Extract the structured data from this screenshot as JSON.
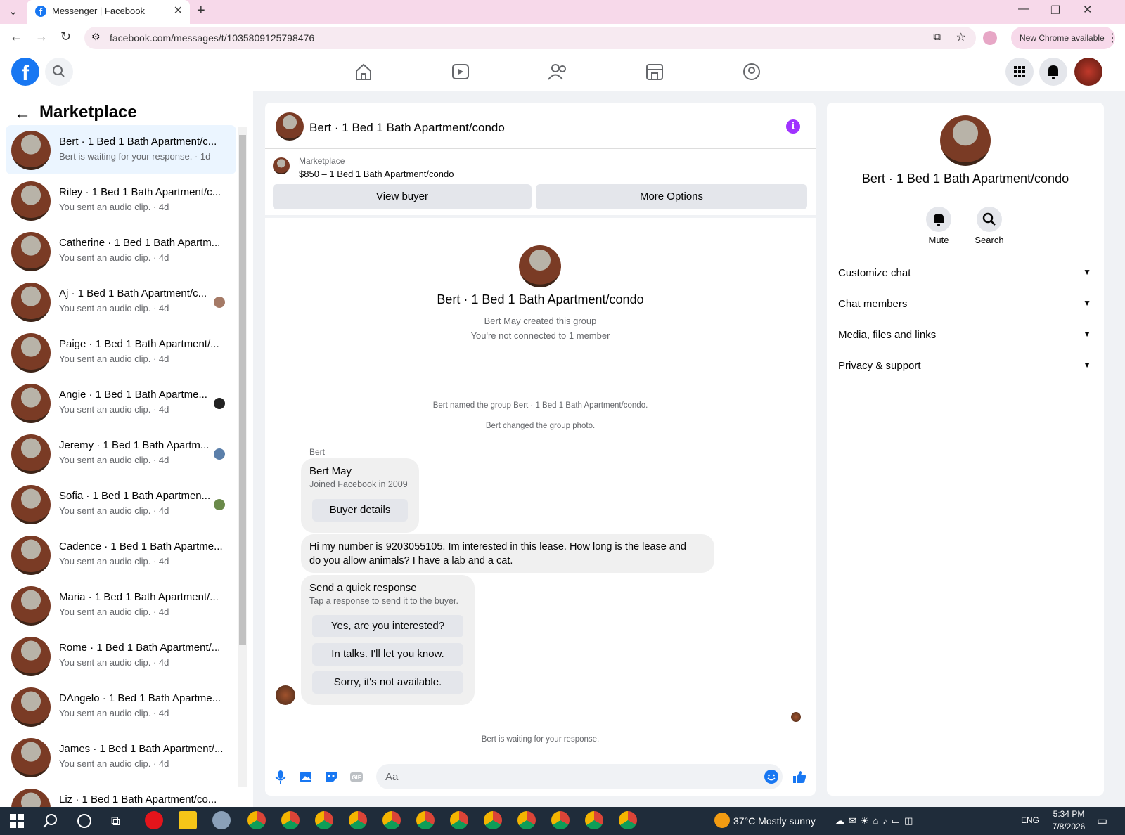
{
  "browser": {
    "tab_title": "Messenger | Facebook",
    "url": "facebook.com/messages/t/1035809125798476",
    "new_chrome": "New Chrome available"
  },
  "left": {
    "title": "Marketplace",
    "conversations": [
      {
        "name": "Bert · 1 Bed 1 Bath Apartment/c...",
        "sub": "Bert is waiting for your response. · 1d"
      },
      {
        "name": "Riley · 1 Bed 1 Bath Apartment/c...",
        "sub": "You sent an audio clip. · 4d"
      },
      {
        "name": "Catherine · 1 Bed 1 Bath Apartm...",
        "sub": "You sent an audio clip. · 4d"
      },
      {
        "name": "Aj · 1 Bed 1 Bath Apartment/c...",
        "sub": "You sent an audio clip. · 4d"
      },
      {
        "name": "Paige · 1 Bed 1 Bath Apartment/...",
        "sub": "You sent an audio clip. · 4d"
      },
      {
        "name": "Angie · 1 Bed 1 Bath Apartme...",
        "sub": "You sent an audio clip. · 4d"
      },
      {
        "name": "Jeremy · 1 Bed 1 Bath Apartm...",
        "sub": "You sent an audio clip. · 4d"
      },
      {
        "name": "Sofia · 1 Bed 1 Bath Apartmen...",
        "sub": "You sent an audio clip. · 4d"
      },
      {
        "name": "Cadence · 1 Bed 1 Bath Apartme...",
        "sub": "You sent an audio clip. · 4d"
      },
      {
        "name": "Maria · 1 Bed 1 Bath Apartment/...",
        "sub": "You sent an audio clip. · 4d"
      },
      {
        "name": "Rome · 1 Bed 1 Bath Apartment/...",
        "sub": "You sent an audio clip. · 4d"
      },
      {
        "name": "DAngelo · 1 Bed 1 Bath Apartme...",
        "sub": "You sent an audio clip. · 4d"
      },
      {
        "name": "James · 1 Bed 1 Bath Apartment/...",
        "sub": "You sent an audio clip. · 4d"
      },
      {
        "name": "Liz · 1 Bed 1 Bath Apartment/co...",
        "sub": ""
      }
    ]
  },
  "chat": {
    "title": "Bert · 1 Bed 1 Bath Apartment/condo",
    "listing_label": "Marketplace",
    "listing_price": "$850 – 1 Bed 1 Bath Apartment/condo",
    "view_buyer": "View buyer",
    "more_options": "More Options",
    "group_name": "Bert · 1 Bed 1 Bath Apartment/condo",
    "created": "Bert May created this group",
    "not_connected": "You're not connected to 1 member",
    "named": "Bert named the group Bert · 1 Bed 1 Bath Apartment/condo.",
    "photo": "Bert changed the group photo.",
    "sender": "Bert",
    "card_name": "Bert May",
    "card_joined": "Joined Facebook in 2009",
    "buyer_details": "Buyer details",
    "message_line1": "Hi my number is 9203055105. Im interested in this lease. How long is the lease and",
    "message_line2": "do you allow animals? I have a lab and a cat.",
    "quick_title": "Send a quick response",
    "quick_sub": "Tap a response to send it to the buyer.",
    "quick_1": "Yes, are you interested?",
    "quick_2": "In talks. I'll let you know.",
    "quick_3": "Sorry, it's not available.",
    "waiting": "Bert is waiting for your response.",
    "composer_placeholder": "Aa"
  },
  "right": {
    "name": "Bert · 1 Bed 1 Bath Apartment/condo",
    "mute": "Mute",
    "search": "Search",
    "rows": [
      "Customize chat",
      "Chat members",
      "Media, files and links",
      "Privacy & support"
    ]
  },
  "taskbar": {
    "weather": "37°C  Mostly sunny",
    "lang": "ENG",
    "time": "5:34 PM",
    "date": "7/8/2026"
  },
  "colors": {
    "fb_blue": "#1877f2",
    "info_purple": "#a033ff",
    "active_row": "#ebf5ff"
  }
}
